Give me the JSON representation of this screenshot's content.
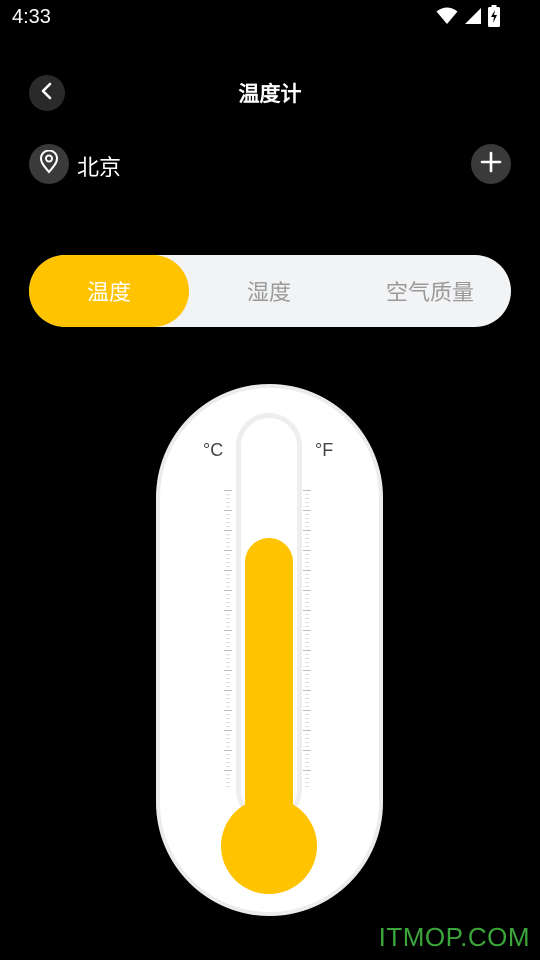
{
  "status_bar": {
    "time": "4:33",
    "icons": [
      "wifi-icon",
      "signal-icon",
      "battery-charging-icon"
    ]
  },
  "header": {
    "title": "温度计",
    "back_icon": "chevron-left-icon"
  },
  "location": {
    "icon": "location-pin-icon",
    "name": "北京",
    "add_icon": "plus-icon"
  },
  "tabs": [
    {
      "label": "温度",
      "active": true
    },
    {
      "label": "湿度",
      "active": false
    },
    {
      "label": "空气质量",
      "active": false
    }
  ],
  "thermometer": {
    "celsius_label": "°C",
    "fahrenheit_label": "°F",
    "level_fraction": 0.72
  },
  "watermark": "ITMOP.COM",
  "colors": {
    "accent": "#ffc300",
    "background": "#000000",
    "tab_bar": "#f1f3f5",
    "button_bg": "#3a3a3a",
    "watermark": "#3aa63a"
  }
}
